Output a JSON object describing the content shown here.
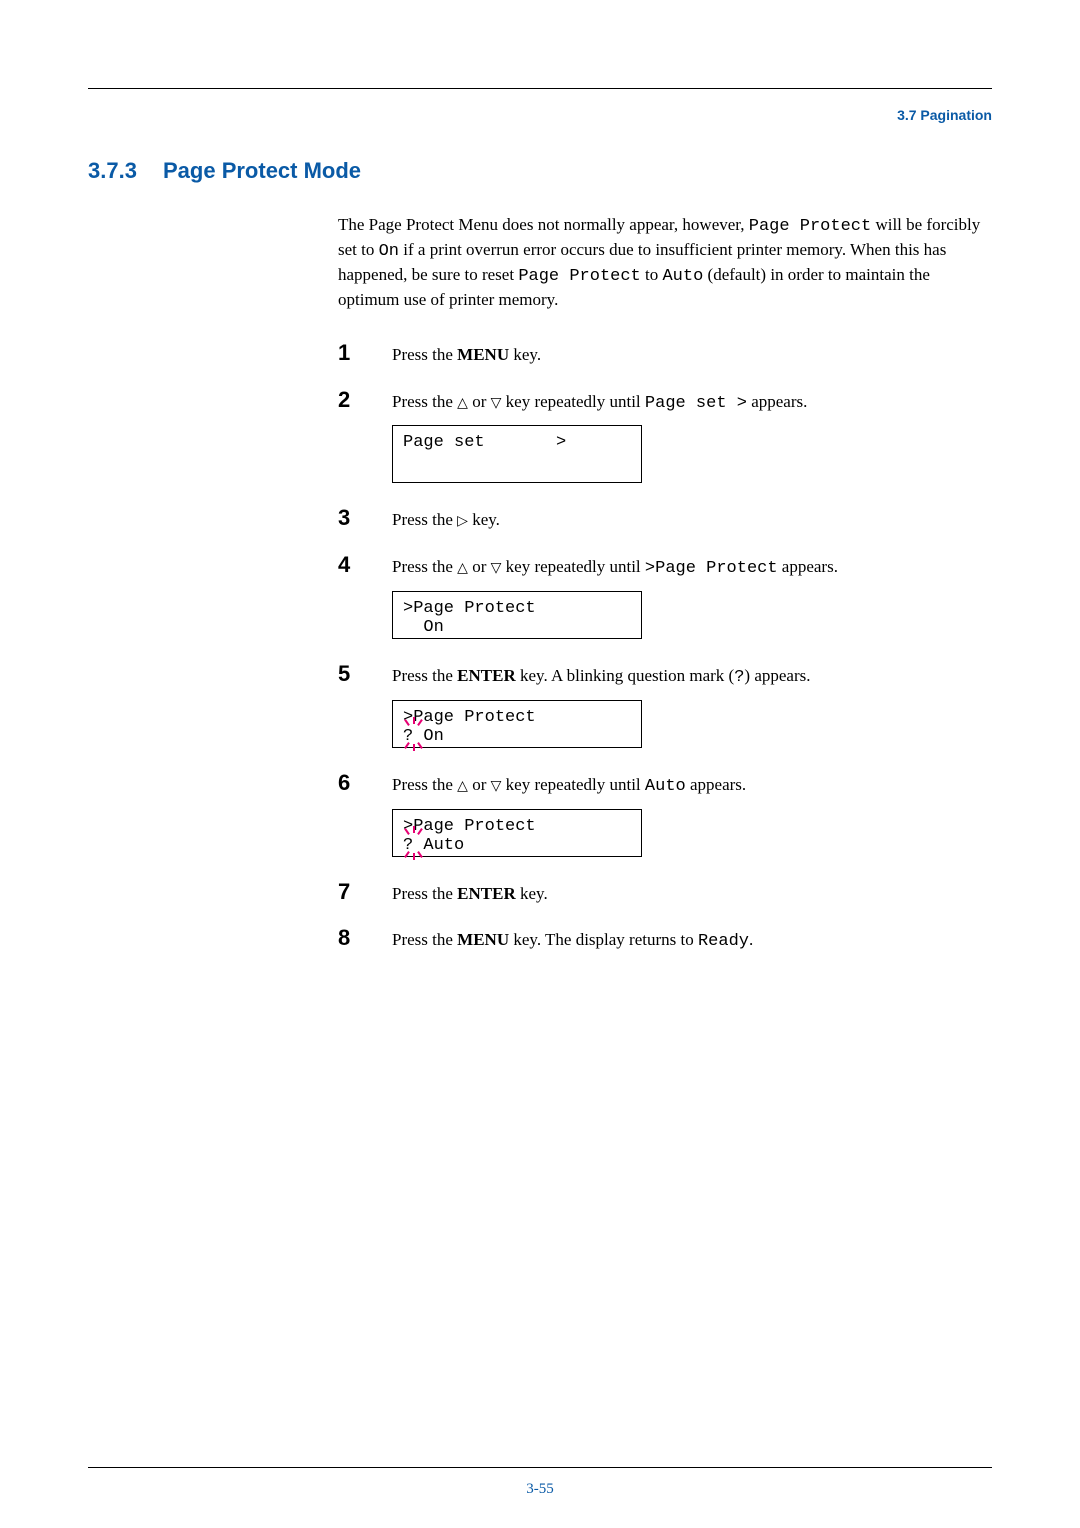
{
  "header": {
    "section_ref": "3.7 Pagination"
  },
  "heading": {
    "number": "3.7.3",
    "title": "Page Protect Mode"
  },
  "intro": {
    "p1a": "The Page Protect Menu does not normally appear, however, ",
    "p1b": "Page Protect",
    "p1c": " will be forcibly set to ",
    "p1d": "On",
    "p1e": " if a print overrun error occurs due to insufficient printer memory. When this has happened, be sure to reset ",
    "p1f": "Page Protect",
    "p1g": " to ",
    "p1h": "Auto",
    "p1i": " (default) in order to maintain the optimum use of printer memory."
  },
  "steps": {
    "s1": {
      "num": "1",
      "a": "Press the ",
      "b": "MENU",
      "c": " key."
    },
    "s2": {
      "num": "2",
      "a": "Press the ",
      "tri1": "△",
      "b": " or ",
      "tri2": "▽",
      "c": " key repeatedly until ",
      "mono": "Page set  >",
      "d": " appears."
    },
    "s3": {
      "num": "3",
      "a": "Press the ",
      "tri": "▷",
      "b": " key."
    },
    "s4": {
      "num": "4",
      "a": "Press the ",
      "tri1": "△",
      "b": " or ",
      "tri2": "▽",
      "c": " key repeatedly until ",
      "mono": ">Page Protect",
      "d": " appears."
    },
    "s5": {
      "num": "5",
      "a": "Press the ",
      "b": "ENTER",
      "c": " key. A blinking question mark (",
      "mono": "?",
      "d": ") appears."
    },
    "s6": {
      "num": "6",
      "a": "Press the ",
      "tri1": "△",
      "b": " or ",
      "tri2": "▽",
      "c": " key repeatedly until ",
      "mono": "Auto",
      "d": " appears."
    },
    "s7": {
      "num": "7",
      "a": "Press the ",
      "b": "ENTER",
      "c": " key."
    },
    "s8": {
      "num": "8",
      "a": "Press the ",
      "b": "MENU",
      "c": " key. The display returns to ",
      "mono": "Ready",
      "d": "."
    }
  },
  "lcds": {
    "lcd1": "Page set       >",
    "lcd2_l1": ">Page Protect",
    "lcd2_l2": "  On",
    "lcd3_l1": ">Page Protect",
    "lcd3_l2": "? On",
    "lcd4_l1": ">Page Protect",
    "lcd4_l2": "? Auto"
  },
  "footer": {
    "page_num": "3-55"
  }
}
